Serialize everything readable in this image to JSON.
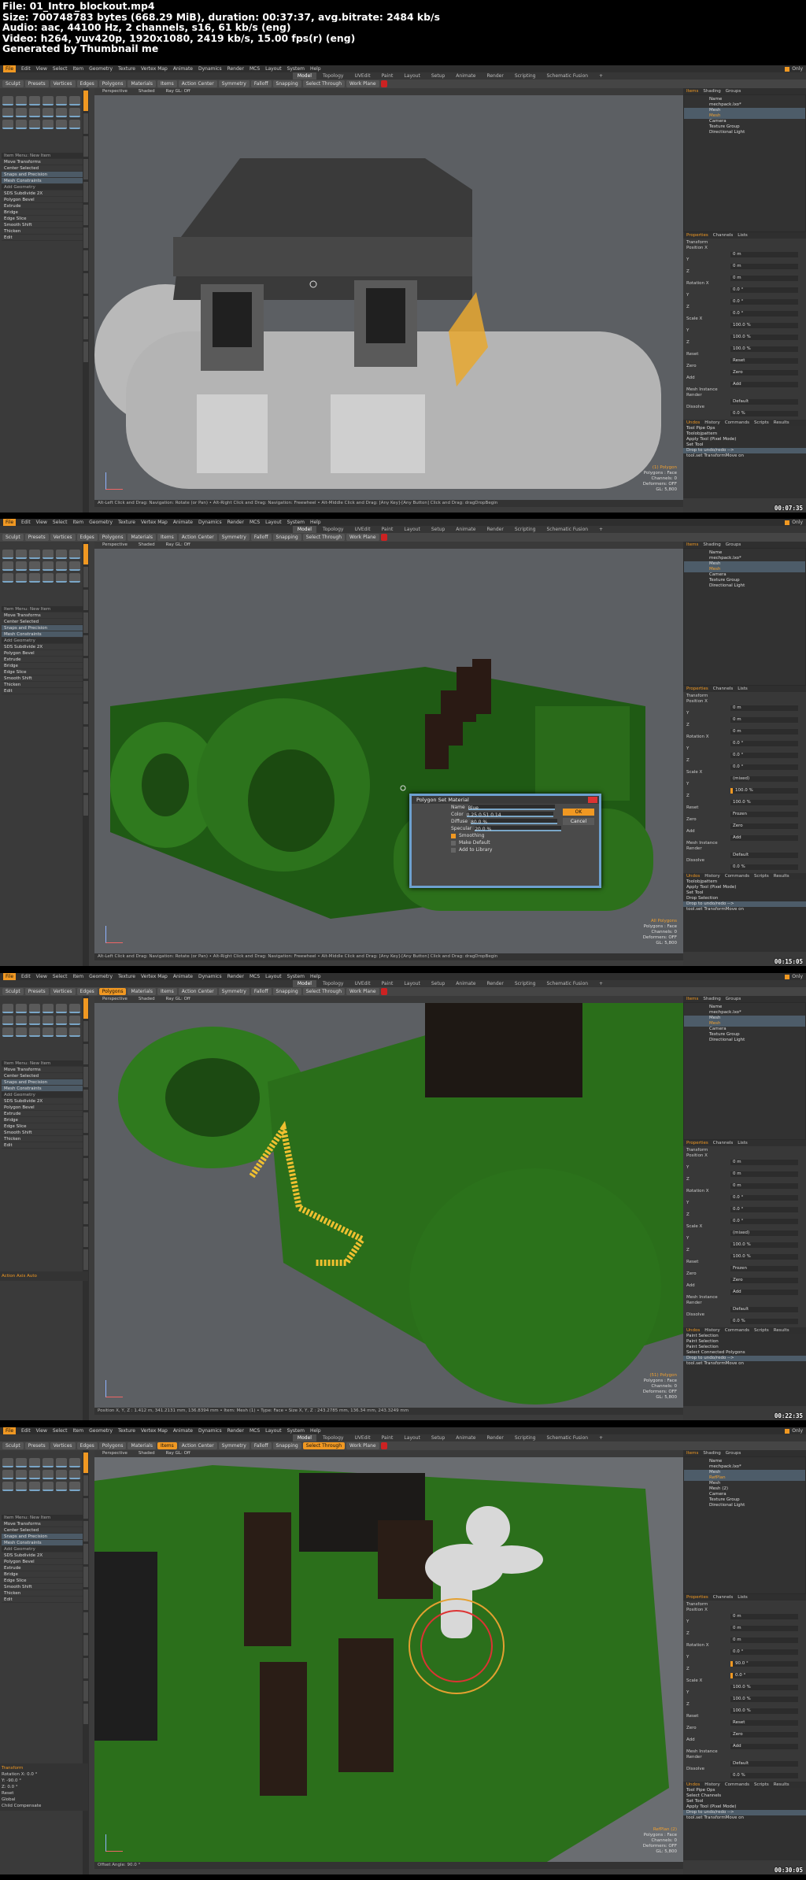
{
  "thumbnail_header": {
    "file": "File: 01_Intro_blockout.mp4",
    "size": "Size: 700748783 bytes (668.29 MiB), duration: 00:37:37, avg.bitrate: 2484 kb/s",
    "audio": "Audio: aac, 44100 Hz, 2 channels, s16, 61 kb/s (eng)",
    "video": "Video: h264, yuv420p, 1920x1080, 2419 kb/s, 15.00 fps(r) (eng)",
    "generator": "Generated by Thumbnail me"
  },
  "menu": [
    "File",
    "Edit",
    "View",
    "Select",
    "Item",
    "Geometry",
    "Texture",
    "Vertex Map",
    "Animate",
    "Dynamics",
    "Render",
    "MCS",
    "Layout",
    "System",
    "Help"
  ],
  "mode_tabs": [
    "Model",
    "Topology",
    "UVEdit",
    "Paint",
    "Layout",
    "Setup",
    "Animate",
    "Render",
    "Scripting",
    "Schematic Fusion",
    "+"
  ],
  "only_label": "Only",
  "toolbar": [
    "Sculpt",
    "Presets",
    "Vertices",
    "Edges",
    "Polygons",
    "Materials",
    "Items",
    "Action Center",
    "Symmetry",
    "Falloff",
    "Snapping",
    "Select Through",
    "Work Plane"
  ],
  "left_list": [
    "Item Menu: New Item",
    "Move Transforms",
    "Center Selected",
    "Snaps and Precision",
    "Mesh Constraints",
    "Add Geometry",
    "SDS Subdivide 2X",
    "Polygon Bevel",
    "Extrude",
    "Bridge",
    "Edge Slice",
    "Smooth Shift",
    "Thicken",
    "Edit"
  ],
  "viewport_tabs": [
    "Perspective",
    "Shaded",
    "Ray GL: Off"
  ],
  "right_tabs": [
    "Items",
    "Shading",
    "Groups"
  ],
  "tree_header": [
    "Name"
  ],
  "property_tabs": [
    "Properties",
    "Channels",
    "Lists"
  ],
  "property_rows": [
    "Transform",
    "Position X",
    "Y",
    "Z",
    "Rotation X",
    "Y",
    "Z",
    "Scale X",
    "Y",
    "Z",
    "Reset",
    "Zero",
    "Add",
    "Mesh Instance",
    "Render",
    "Dissolve"
  ],
  "cmd_tabs": [
    "Undos",
    "History",
    "Commands",
    "Scripts",
    "Results"
  ],
  "cmd_input": "tool.set TransformMove on",
  "frames": [
    {
      "timestamp": "00:07:35",
      "tree": [
        "mechpack.lxo*",
        "Mesh",
        "Mesh",
        "Camera",
        "Texture Group",
        "Directional Light"
      ],
      "tree_active": 2,
      "values": [
        "0 m",
        "0 m",
        "0 m",
        "0.0 °",
        "0.0 °",
        "0.0 °",
        "100.0 %",
        "100.0 %",
        "100.0 %",
        "Reset",
        "Zero",
        "Add",
        "Default",
        "0.0 %"
      ],
      "history": [
        "Tool Pipe Ops",
        "Toolobjpattern",
        "Apply Tool (Pixel Mode)",
        "Set Tool",
        "Drop to undo/redo -->"
      ],
      "vp_info": [
        "(1) Polygon",
        "Polygons : Face",
        "Channels: 0",
        "Deformers: OFF",
        "GL: 5,800"
      ],
      "status": "Alt-Left Click and Drag: Navigation: Rotate (or Pan) • Alt-Right Click and Drag: Navigation: Freewheel • Alt-Middle Click and Drag: [Any Key]-[Any Button] Click and Drag: dragDropBegin"
    },
    {
      "timestamp": "00:15:05",
      "tree": [
        "mechpack.lxo*",
        "Mesh",
        "Mesh",
        "Camera",
        "Texture Group",
        "Directional Light"
      ],
      "tree_active": 2,
      "values": [
        "0 m",
        "0 m",
        "0 m",
        "0.0 °",
        "0.0 °",
        "0.0 °",
        "(mixed)",
        "100.0 %",
        "100.0 %",
        "Frozen",
        "Zero",
        "Add",
        "Default",
        "0.0 %"
      ],
      "history": [
        "Toolobjpattern",
        "Apply Tool (Pixel Mode)",
        "Set Tool",
        "Drop Selection",
        "Drop to undo/redo -->"
      ],
      "vp_info": [
        "All Polygons",
        "Polygons : Face",
        "Channels: 0",
        "Deformers: OFF",
        "GL: 5,800"
      ],
      "status": "Alt-Left Click and Drag: Navigation: Rotate (or Pan) • Alt-Right Click and Drag: Navigation: Freewheel • Alt-Middle Click and Drag: [Any Key]-[Any Button] Click and Drag: dragDropBegin"
    },
    {
      "timestamp": "00:22:35",
      "tree": [
        "mechpack.lxo*",
        "Mesh",
        "Mesh",
        "Camera",
        "Texture Group",
        "Directional Light"
      ],
      "tree_active": 2,
      "values": [
        "0 m",
        "0 m",
        "0 m",
        "0.0 °",
        "0.0 °",
        "0.0 °",
        "(mixed)",
        "100.0 %",
        "100.0 %",
        "Frozen",
        "Zero",
        "Add",
        "Default",
        "0.0 %"
      ],
      "history": [
        "Paint Selection",
        "Paint Selection",
        "Paint Selection",
        "Select Connected Polygons",
        "Drop to undo/redo -->"
      ],
      "vp_info": [
        "(51) Polygon",
        "Polygons : Face",
        "Channels: 0",
        "Deformers: OFF",
        "GL: 5,800"
      ],
      "status": "Position X, Y, Z : 1.412 m, 341.2131 mm, 136.8394 mm • Item: Mesh (1) • Type: Face • Size X, Y, Z : 243.2785 mm, 136.34 mm, 243.3249 mm",
      "axis_label": "Action Axis Auto",
      "dialog": {
        "title": "Polygon Set Material",
        "name_label": "Name",
        "name_value": "Blue",
        "color_label": "Color",
        "color_values": "0.25   0.51   0.14",
        "diffuse_label": "Diffuse",
        "diffuse_value": "80.0 %",
        "specular_label": "Specular",
        "specular_value": "20.0 %",
        "smoothing": "Smoothing",
        "make_default": "Make Default",
        "add_to_library": "Add to Library",
        "ok": "OK",
        "cancel": "Cancel"
      }
    },
    {
      "timestamp": "00:30:05",
      "tree": [
        "mechpack.lxo*",
        "Mesh",
        "RefPlan",
        "Mesh",
        "Mesh (2)",
        "Camera",
        "Texture Group",
        "Directional Light"
      ],
      "tree_active": 2,
      "values": [
        "0 m",
        "0 m",
        "0 m",
        "0.0 °",
        "90.0 °",
        "0.0 °",
        "100.0 %",
        "100.0 %",
        "100.0 %",
        "Reset",
        "Zero",
        "Add",
        "Default",
        "0.0 %"
      ],
      "history": [
        "Tool Pipe Ops",
        "Select Channels",
        "Set Tool",
        "Apply Tool (Pixel Mode)",
        "Drop to undo/redo -->"
      ],
      "vp_info": [
        "RefPlan (2)",
        "Polygons : Face",
        "Channels: 0",
        "Deformers: OFF",
        "GL: 5,800"
      ],
      "status": "Offset Angle: 90.0 °",
      "transform_panel": [
        "Transform",
        "Rotation X: 0.0 °",
        "Y: -90.0 °",
        "Z: 0.0 °",
        "Reset",
        "Global",
        "Child Compensate"
      ]
    }
  ]
}
